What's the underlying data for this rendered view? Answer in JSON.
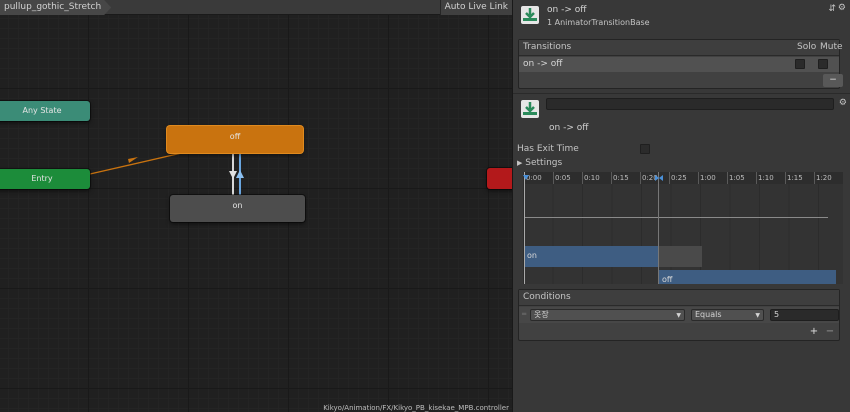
{
  "graph": {
    "breadcrumb": "pullup_gothic_Stretch",
    "auto_live_link_label": "Auto Live Link",
    "nodes": {
      "any_state": "Any State",
      "entry": "Entry",
      "off": "off",
      "on": "on"
    },
    "path": "Kikyo/Animation/FX/Kikyo_PB_kisekae_MPB.controller",
    "colors": {
      "any_state": "#3b8c77",
      "entry": "#1c8c3a",
      "default_state": "#c9730f",
      "state": "#4d4d4d",
      "exit": "#b3191b",
      "transition_arrow": "#c9730f",
      "selected_transition": "#6aa6e0"
    }
  },
  "inspector": {
    "header": {
      "title": "on -> off",
      "subtitle": "1 AnimatorTransitionBase",
      "icon": "transition-icon"
    },
    "transitions": {
      "title": "Transitions",
      "solo_label": "Solo",
      "mute_label": "Mute",
      "rows": [
        {
          "label": "on -> off",
          "solo": false,
          "mute": false
        }
      ],
      "remove_label": "−"
    },
    "settings": {
      "name_value": "",
      "transition_label": "on -> off",
      "has_exit_time_label": "Has Exit Time",
      "has_exit_time": false,
      "settings_label": "Settings"
    },
    "timeline": {
      "ticks": [
        "0:00",
        "0:05",
        "0:10",
        "0:15",
        "0:20",
        "0:25",
        "1:00",
        "1:05",
        "1:10",
        "1:15",
        "1:20"
      ],
      "clips": {
        "on": "on",
        "off": "off"
      }
    },
    "conditions": {
      "title": "Conditions",
      "rows": [
        {
          "parameter": "옷장",
          "operator": "Equals",
          "value": "5"
        }
      ],
      "add_label": "+",
      "remove_label": "−"
    }
  }
}
